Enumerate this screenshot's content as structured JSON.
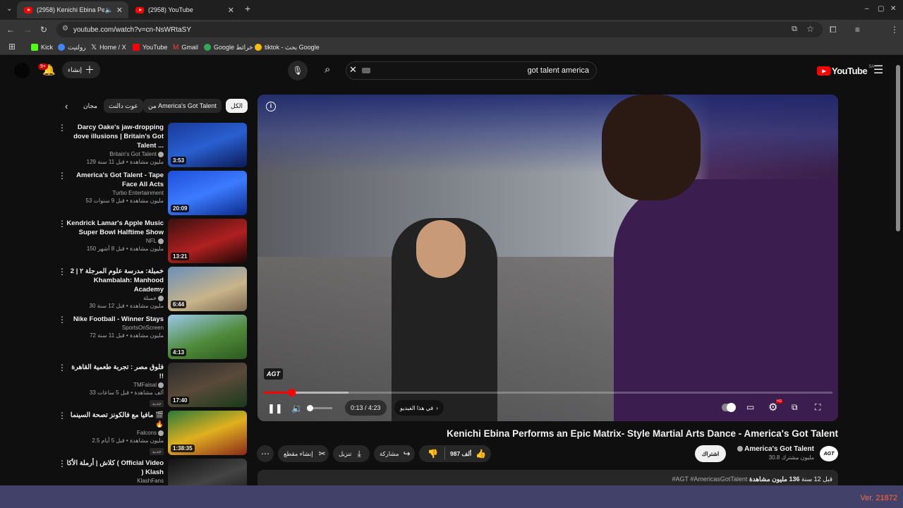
{
  "browser": {
    "tabs": [
      {
        "title": "(2958) Kenichi Ebina Perform",
        "audio_icon": "speaker-icon",
        "active": true
      },
      {
        "title": "(2958) YouTube",
        "active": false
      }
    ],
    "new_tab": "+",
    "url": "youtube.com/watch?v=cn-NsWRtaSY",
    "bookmarks": [
      {
        "label": "Kick",
        "icon": "kick-icon",
        "color": "#53fc18"
      },
      {
        "label": "رولتيت",
        "icon": "google-icon",
        "color": "#4285f4"
      },
      {
        "label": "Home / X",
        "icon": "x-icon",
        "color": "#ffffff"
      },
      {
        "label": "YouTube",
        "icon": "youtube-icon",
        "color": "#ff0000"
      },
      {
        "label": "Gmail",
        "icon": "gmail-icon",
        "color": "#ea4335"
      },
      {
        "label": "Google خرائط",
        "icon": "google-icon",
        "color": "#34a853"
      },
      {
        "label": "tiktok - بحث Google",
        "icon": "google-icon",
        "color": "#fbbc05"
      }
    ]
  },
  "header": {
    "create_label": "إنشاء",
    "notification_count": "9+",
    "search_query": "got talent america",
    "logo_text": "YouTube",
    "logo_region": "SA"
  },
  "chips": [
    "الكل",
    "من America's Got Talent",
    "عوت دالنت",
    "مجان"
  ],
  "recommendations": [
    {
      "title": "Darcy Oake's jaw-dropping dove illusions | Britain's Got Talent ...",
      "channel": "Britain's Got Talent",
      "verified": true,
      "meta": "129 مليون مشاهدة • قبل 11 سنة",
      "duration": "3:53",
      "thumb": "linear-gradient(160deg,#1a3a9a,#2a5fd0 50%,#0b1a55)"
    },
    {
      "title": "America's Got Talent - Tape Face All Acts",
      "channel": "Turbo Entertainment",
      "verified": false,
      "meta": "53 مليون مشاهدة • قبل 9 سنوات",
      "duration": "20:09",
      "thumb": "linear-gradient(160deg,#1e4fd8,#3c7bff 50%,#0c2a8a)"
    },
    {
      "title": "Kendrick Lamar's Apple Music Super Bowl Halftime Show",
      "channel": "NFL",
      "verified": true,
      "meta": "150 مليون مشاهدة • قبل 8 أشهر",
      "duration": "13:21",
      "thumb": "linear-gradient(160deg,#3a1010,#b02020 55%,#1a0606)"
    },
    {
      "title": "خمبلة: مدرسة علوم المرجلة ٢ | 2 Khambalah: Manhood Academy",
      "channel": "خمبلة",
      "verified": true,
      "meta": "30 مليون مشاهدة • قبل 12 سنة",
      "duration": "6:44",
      "thumb": "linear-gradient(160deg,#6a8fb8,#c9b48a 60%,#7a6a50)"
    },
    {
      "title": "Nike Football  - Winner Stays",
      "channel": "SportsOnScreen",
      "verified": false,
      "meta": "72 مليون مشاهدة • قبل 11 سنة",
      "duration": "4:13",
      "thumb": "linear-gradient(160deg,#9bc8e8,#4f8a3a 55%,#2d5a20)"
    },
    {
      "title": "فلوق مصر : تجربة طعمية القاهرة !!",
      "channel": "TMFaisal",
      "verified": true,
      "meta": "33 ألف مشاهدة • قبل 5 ساعات",
      "new": "جديد",
      "duration": "17:40",
      "thumb": "linear-gradient(160deg,#2a2a2a,#5a4a3a 50%,#1a3a1a)"
    },
    {
      "title": "مافيا مع فالكونز تصحة السينما 🎬 🔥",
      "channel": "Falcons",
      "verified": true,
      "meta": "2.5 مليون مشاهدة • قبل 5 أيام",
      "new": "جديد",
      "duration": "1:38:35",
      "thumb": "linear-gradient(160deg,#2a7a3a,#e0b020 50%,#8a2a1a)"
    },
    {
      "title": "كلاش | أرملة الأكا ( Official Video )  Klash",
      "channel": "KlashFans",
      "verified": false,
      "meta": "",
      "duration": "",
      "thumb": "linear-gradient(160deg,#111,#444 50%,#111)"
    }
  ],
  "player": {
    "current_time": "0:13",
    "total_time": "4:23",
    "time_text": "0:13 / 4:23",
    "chapter_text": "في هذا الفيديو",
    "progress_fraction": 0.049,
    "buffered_fraction": 0.15,
    "watermark": "AGT",
    "info_icon": "info-icon",
    "hd_badge": "HD"
  },
  "video": {
    "title": "Kenichi Ebina Performs an Epic Matrix- Style Martial Arts Dance - America's Got Talent",
    "channel_name": "America's Got Talent",
    "channel_avatar_text": "AGT",
    "subscribers": "30.8 مليون مشترك",
    "subscribe_label": "اشتراك",
    "likes": "987 ألف",
    "share_label": "مشاركة",
    "download_label": "تنزيل",
    "clip_label": "إنشاء مقطع",
    "views_bold": "136 مليون مشاهدة",
    "age": "قبل 12 سنة",
    "hashtags": "#AGT #AmericasGotTalent"
  },
  "taskbar": {
    "version": "Ver. 21872"
  }
}
